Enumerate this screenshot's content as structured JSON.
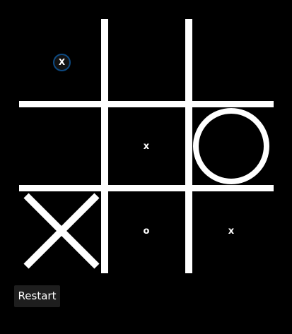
{
  "game": {
    "board": [
      [
        "",
        "",
        ""
      ],
      [
        "",
        "x",
        "O"
      ],
      [
        "X",
        "o",
        "x"
      ]
    ],
    "current_player_badge": "X",
    "colors": {
      "background": "#000000",
      "lines": "#ffffff",
      "badge_ring": "#0d4a82",
      "button_background": "#1e1e1e"
    }
  },
  "controls": {
    "restart_label": "Restart"
  }
}
